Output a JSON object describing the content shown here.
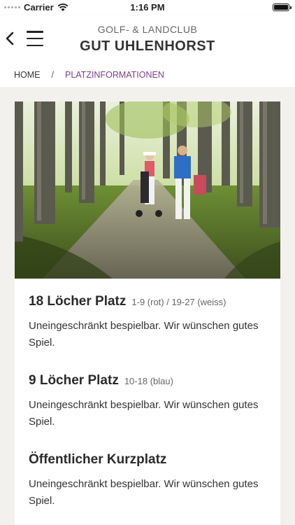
{
  "status_bar": {
    "carrier": "Carrier",
    "time": "1:16 PM"
  },
  "header": {
    "subtitle": "GOLF- & LANDCLUB",
    "title": "GUT UHLENHORST"
  },
  "breadcrumb": {
    "home": "HOME",
    "separator": "/",
    "current": "PLATZINFORMATIONEN"
  },
  "courses": [
    {
      "name": "18 Löcher Platz",
      "holes": "1-9 (rot) / 19-27 (weiss)",
      "status": "Uneingeschränkt bespielbar. Wir wünschen gutes Spiel."
    },
    {
      "name": "9 Löcher Platz",
      "holes": "10-18 (blau)",
      "status": "Uneingeschränkt bespielbar. Wir wünschen gutes Spiel."
    },
    {
      "name": "Öffentlicher Kurzplatz",
      "holes": "",
      "status": "Uneingeschränkt bespielbar. Wir wünschen gutes Spiel."
    }
  ],
  "colors": {
    "accent": "#7b3f8c",
    "background": "#f2f1ed"
  }
}
